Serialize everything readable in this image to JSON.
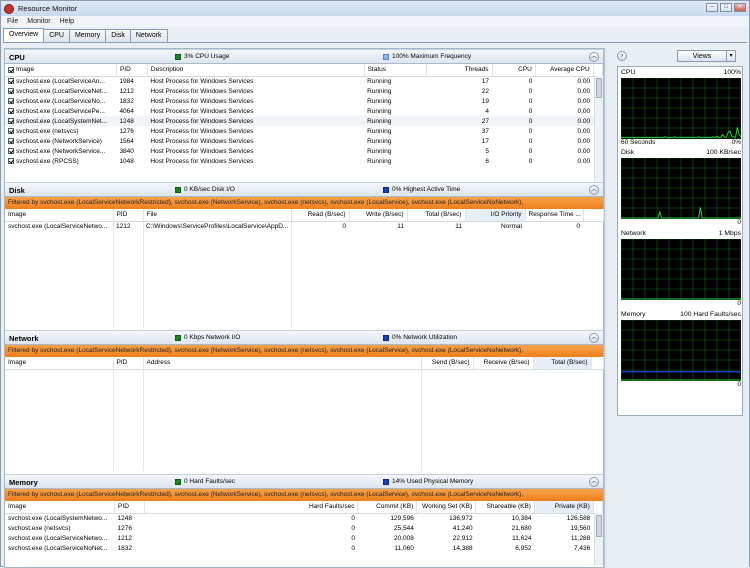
{
  "window": {
    "title": "Resource Monitor"
  },
  "menu": [
    "File",
    "Monitor",
    "Help"
  ],
  "tabs": [
    "Overview",
    "CPU",
    "Memory",
    "Disk",
    "Network"
  ],
  "colors": {
    "filter_bar": "#f7941d",
    "graph_green": "#1fcf3a",
    "graph_grid": "#106a19",
    "active_blue": "#1a3cc8"
  },
  "cpu": {
    "name": "CPU",
    "stat1": "3% CPU Usage",
    "stat2": "100% Maximum Frequency",
    "columns": [
      "Image",
      "PID",
      "Description",
      "Status",
      "Threads",
      "CPU",
      "Average CPU"
    ],
    "rows": [
      [
        "svchost.exe (LocalServiceAn...",
        "1984",
        "Host Process for Windows Services",
        "Running",
        "17",
        "0",
        "0.00"
      ],
      [
        "svchost.exe (LocalServiceNet...",
        "1212",
        "Host Process for Windows Services",
        "Running",
        "22",
        "0",
        "0.00"
      ],
      [
        "svchost.exe (LocalServiceNo...",
        "1832",
        "Host Process for Windows Services",
        "Running",
        "19",
        "0",
        "0.00"
      ],
      [
        "svchost.exe (LocalServicePe...",
        "4064",
        "Host Process for Windows Services",
        "Running",
        "4",
        "0",
        "0.00"
      ],
      [
        "svchost.exe (LocalSystemNet...",
        "1248",
        "Host Process for Windows Services",
        "Running",
        "27",
        "0",
        "0.00"
      ],
      [
        "svchost.exe (netsvcs)",
        "1276",
        "Host Process for Windows Services",
        "Running",
        "37",
        "0",
        "0.00"
      ],
      [
        "svchost.exe (NetworkService)",
        "1564",
        "Host Process for Windows Services",
        "Running",
        "17",
        "0",
        "0.00"
      ],
      [
        "svchost.exe (NetworkService...",
        "3840",
        "Host Process for Windows Services",
        "Running",
        "5",
        "0",
        "0.00"
      ],
      [
        "svchost.exe (RPCSS)",
        "1048",
        "Host Process for Windows Services",
        "Running",
        "6",
        "0",
        "0.00"
      ]
    ]
  },
  "disk": {
    "name": "Disk",
    "stat1": "0 KB/sec Disk I/O",
    "stat2": "0% Highest Active Time",
    "filter": "Filtered by svchost.exe (LocalServiceNetworkRestricted), svchost.exe (NetworkService), svchost.exe (netsvcs), svchost.exe (LocalService), svchost.exe (LocalServiceNoNetwork),",
    "columns": [
      "Image",
      "PID",
      "File",
      "Read (B/sec)",
      "Write (B/sec)",
      "Total (B/sec)",
      "I/O Priority",
      "Response Time ..."
    ],
    "rows": [
      [
        "svchost.exe (LocalServiceNetwo...",
        "1212",
        "C:\\Windows\\ServiceProfiles\\LocalService\\AppD...",
        "0",
        "11",
        "11",
        "Normal",
        "0"
      ]
    ]
  },
  "network": {
    "name": "Network",
    "stat1": "0 Kbps Network I/O",
    "stat2": "0% Network Utilization",
    "filter": "Filtered by svchost.exe (LocalServiceNetworkRestricted), svchost.exe (NetworkService), svchost.exe (netsvcs), svchost.exe (LocalService), svchost.exe (LocalServiceNoNetwork),",
    "columns": [
      "Image",
      "PID",
      "Address",
      "Send (B/sec)",
      "Receive (B/sec)",
      "Total (B/sec)"
    ]
  },
  "memory": {
    "name": "Memory",
    "stat1": "0 Hard Faults/sec",
    "stat2": "14% Used Physical Memory",
    "filter": "Filtered by svchost.exe (LocalServiceNetworkRestricted), svchost.exe (NetworkService), svchost.exe (netsvcs), svchost.exe (LocalService), svchost.exe (LocalServiceNoNetwork),",
    "columns": [
      "Image",
      "PID",
      "Hard Faults/sec",
      "Commit (KB)",
      "Working Set (KB)",
      "Shareable (KB)",
      "Private (KB)"
    ],
    "rows": [
      [
        "svchost.exe (LocalSystemNetwo...",
        "1248",
        "0",
        "129,596",
        "136,972",
        "10,384",
        "126,588"
      ],
      [
        "svchost.exe (netsvcs)",
        "1276",
        "0",
        "25,544",
        "41,240",
        "21,680",
        "19,560"
      ],
      [
        "svchost.exe (LocalServiceNetwo...",
        "1212",
        "0",
        "20,008",
        "22,912",
        "11,624",
        "11,288"
      ],
      [
        "svchost.exe (LocalServiceNoNet...",
        "1832",
        "0",
        "11,060",
        "14,388",
        "6,952",
        "7,436"
      ]
    ]
  },
  "side": {
    "views_label": "Views",
    "graphs": [
      {
        "name": "CPU",
        "max": "100%",
        "foot_left": "60 Seconds",
        "foot_right": "0%",
        "series": [
          1,
          1,
          1,
          1,
          1,
          1,
          1,
          1,
          1,
          1,
          1,
          1,
          1,
          1,
          1,
          1,
          1,
          1,
          1,
          1,
          1,
          1,
          1,
          1,
          2,
          1,
          1,
          1,
          1,
          2,
          1,
          1,
          1,
          1,
          1,
          1,
          1,
          1,
          1,
          1,
          1,
          1,
          2,
          1,
          1,
          1,
          1,
          1,
          1,
          1,
          2,
          1,
          3,
          1,
          1,
          6,
          2,
          1,
          9,
          12,
          3,
          2,
          1,
          18,
          5,
          2
        ]
      },
      {
        "name": "Disk",
        "max": "100 KB/sec",
        "foot_left": "",
        "foot_right": "0",
        "series": [
          0,
          0,
          0,
          0,
          0,
          0,
          0,
          0,
          0,
          0,
          0,
          0,
          0,
          0,
          0,
          0,
          0,
          0,
          0,
          0,
          0,
          10,
          0,
          0,
          0,
          0,
          0,
          0,
          0,
          0,
          0,
          0,
          0,
          0,
          0,
          0,
          0,
          0,
          0,
          0,
          0,
          0,
          0,
          18,
          0,
          0,
          0,
          0,
          0,
          0,
          0,
          0,
          0,
          0,
          0,
          0,
          0,
          0,
          0,
          0,
          0,
          0,
          0,
          0,
          0,
          0
        ]
      },
      {
        "name": "Network",
        "max": "1 Mbps",
        "foot_left": "",
        "foot_right": "0",
        "series": [
          0,
          0,
          0,
          0,
          0,
          0,
          0,
          0,
          0,
          0,
          0,
          0,
          0,
          0,
          0,
          0,
          0,
          0,
          0,
          0,
          0,
          0,
          0,
          0,
          0,
          0,
          0,
          0,
          0,
          0,
          0,
          0,
          0,
          0,
          0,
          0,
          0,
          0,
          0,
          0,
          0,
          0,
          0,
          0,
          0,
          0,
          0,
          0,
          0,
          0,
          0,
          0,
          0,
          0,
          0,
          0,
          0,
          0,
          0,
          0,
          0,
          0,
          0,
          0,
          0,
          0
        ]
      },
      {
        "name": "Memory",
        "max": "100 Hard Faults/sec",
        "foot_left": "",
        "foot_right": "0",
        "series": [
          0,
          0,
          0,
          0,
          0,
          0,
          0,
          0,
          0,
          0,
          0,
          0,
          0,
          0,
          0,
          0,
          0,
          0,
          0,
          0,
          0,
          0,
          0,
          0,
          0,
          0,
          0,
          0,
          0,
          0,
          0,
          0,
          0,
          0,
          0,
          0,
          0,
          0,
          0,
          0,
          0,
          0,
          0,
          0,
          0,
          0,
          0,
          0,
          0,
          0,
          0,
          0,
          0,
          0,
          0,
          0,
          0,
          0,
          0,
          0,
          0,
          0,
          0,
          0,
          0,
          0
        ],
        "level": 14
      }
    ]
  }
}
